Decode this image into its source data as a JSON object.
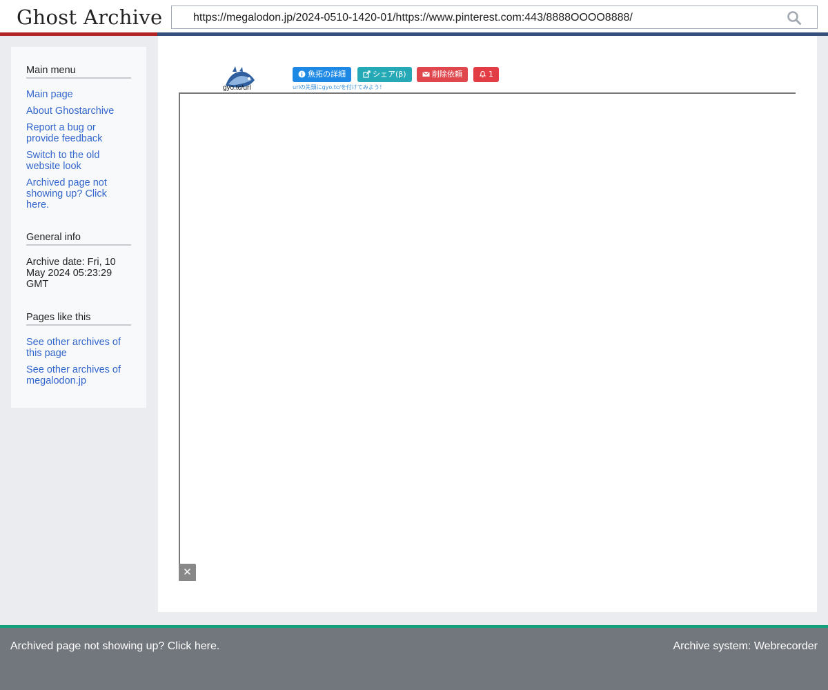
{
  "header": {
    "logo": "Ghost Archive",
    "search_value": "https://megalodon.jp/2024-0510-1420-01/https://www.pinterest.com:443/8888OOOO8888/"
  },
  "sidebar": {
    "main_menu": {
      "heading": "Main menu",
      "items": [
        {
          "label": "Main page"
        },
        {
          "label": "About Ghostarchive"
        },
        {
          "label": "Report a bug or provide feedback"
        },
        {
          "label": "Switch to the old website look"
        },
        {
          "label": "Archived page not showing up? Click here."
        }
      ]
    },
    "general_info": {
      "heading": "General info",
      "archive_date": "Archive date: Fri, 10 May 2024 05:23:29 GMT"
    },
    "pages_like_this": {
      "heading": "Pages like this",
      "items": [
        {
          "label": "See other archives of this page"
        },
        {
          "label": "See other archives of megalodon.jp"
        }
      ]
    }
  },
  "content": {
    "gyo_label": "gyo.tc/url",
    "buttons": {
      "details": "魚拓の詳細",
      "share": "シェア(β)",
      "delete": "削除依頼",
      "notify": "1"
    },
    "hint": "urlの先頭にgyo.tc/を付けてみよう！",
    "close_symbol": "✕"
  },
  "footer": {
    "left": "Archived page not showing up? Click here.",
    "right": "Archive system: Webrecorder"
  },
  "colors": {
    "accent_red": "#b32424",
    "accent_blue": "#36507e",
    "link": "#3366cc",
    "footer_bg": "#72777d",
    "footer_green": "#14a07a"
  }
}
